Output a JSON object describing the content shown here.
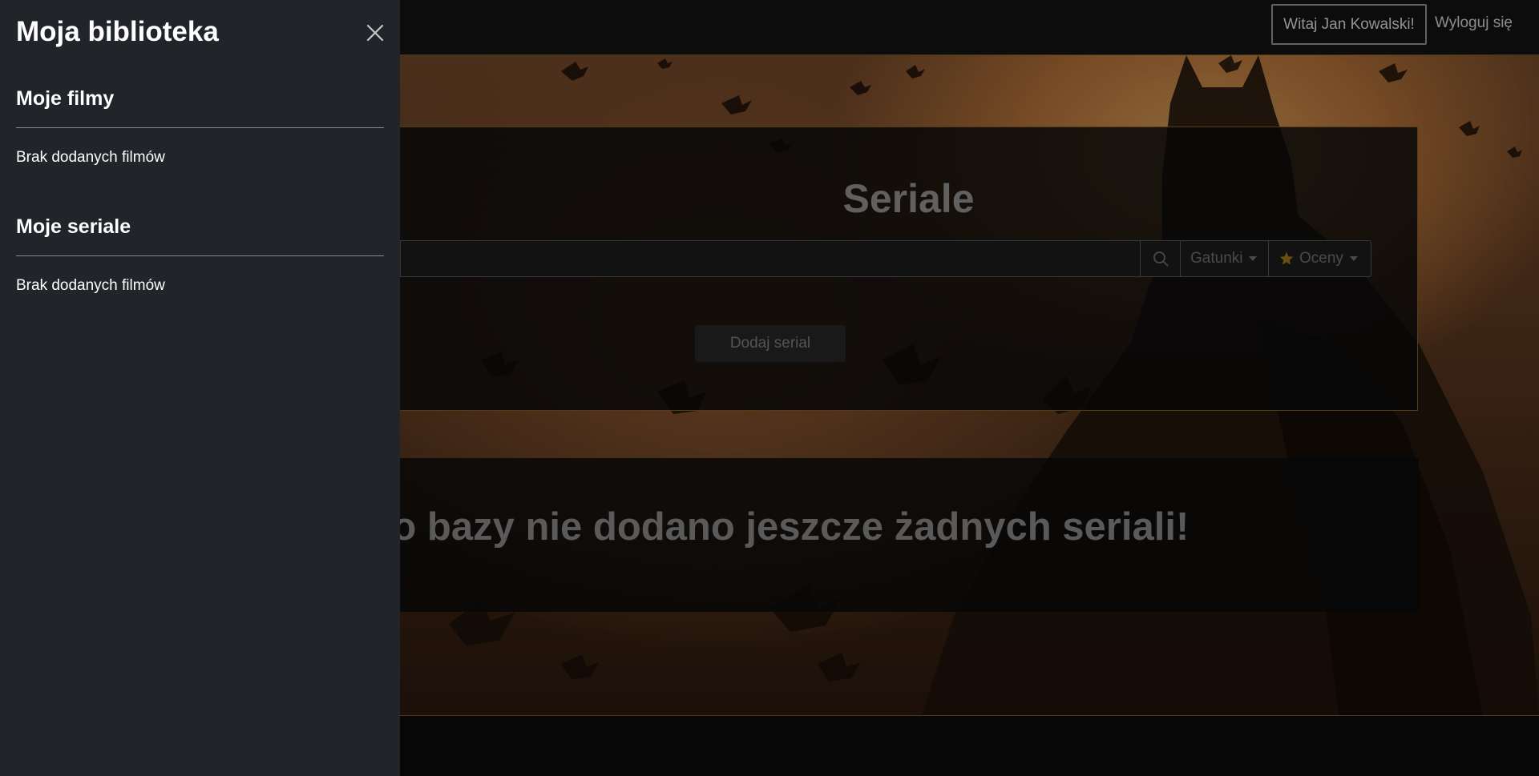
{
  "navbar": {
    "greeting": "Witaj Jan Kowalski!",
    "logout": "Wyloguj się"
  },
  "main": {
    "title": "Seriale",
    "search": {
      "value": "",
      "placeholder": "",
      "icon": "search-icon"
    },
    "genres_label": "Gatunki",
    "ratings_label": "Oceny",
    "ratings_icon": "star-icon",
    "add_label": "Dodaj serial",
    "empty_message": "Do bazy nie dodano jeszcze żadnych seriali!"
  },
  "sidebar": {
    "title": "Moja biblioteka",
    "close_icon": "close-icon",
    "sections": [
      {
        "title": "Moje filmy",
        "empty": "Brak dodanych filmów"
      },
      {
        "title": "Moje seriale",
        "empty": "Brak dodanych filmów"
      }
    ]
  },
  "colors": {
    "sidebar_bg": "#212529",
    "accent_border": "#7a5a22",
    "star": "#b8860b"
  }
}
